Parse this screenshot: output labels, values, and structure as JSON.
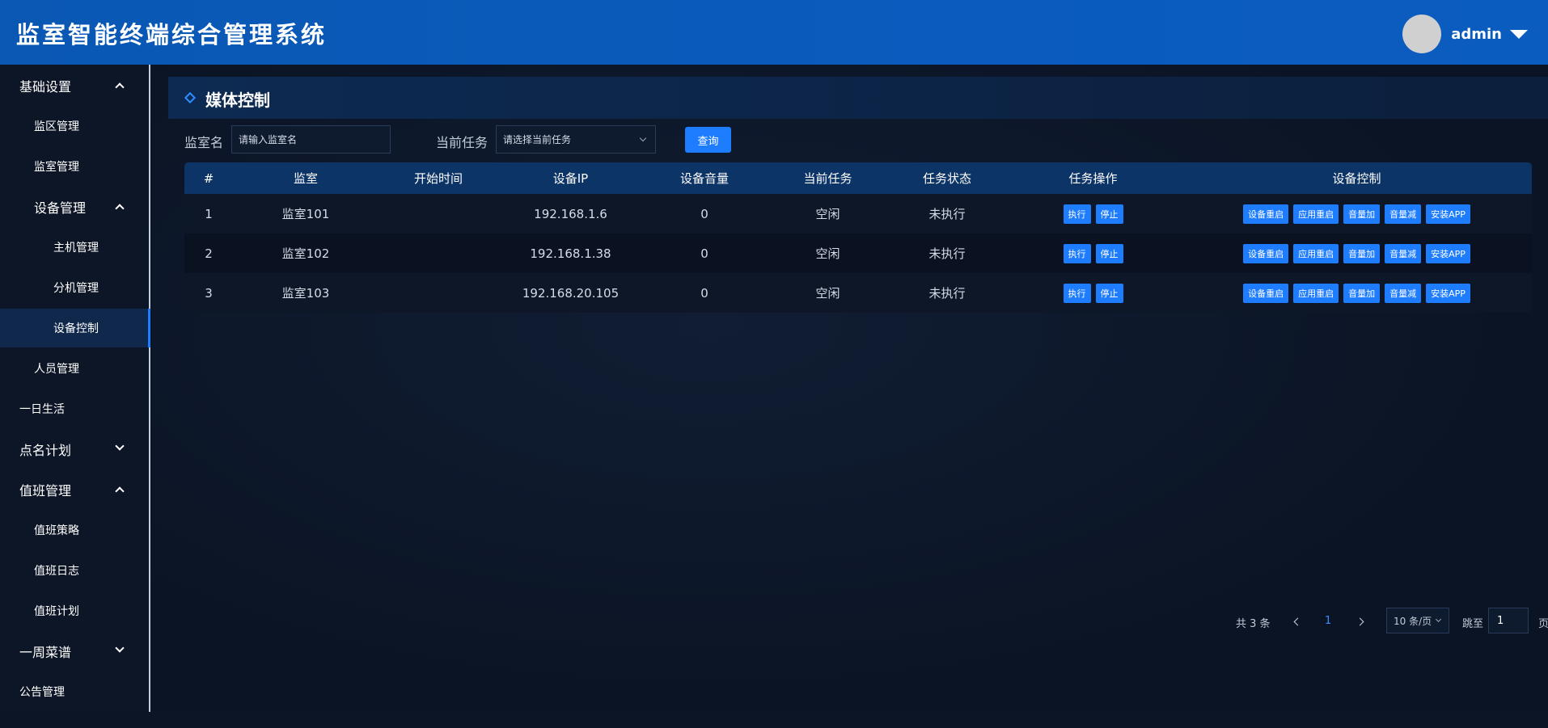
{
  "header": {
    "title": "监室智能终端综合管理系统",
    "user_name": "admin"
  },
  "sidebar": {
    "items": [
      {
        "label": "基础设置"
      },
      {
        "label": "监区管理"
      },
      {
        "label": "监室管理"
      },
      {
        "label": "设备管理"
      },
      {
        "label": "主机管理"
      },
      {
        "label": "分机管理"
      },
      {
        "label": "设备控制"
      },
      {
        "label": "人员管理"
      },
      {
        "label": "一日生活"
      },
      {
        "label": "点名计划"
      },
      {
        "label": "值班管理"
      },
      {
        "label": "值班策略"
      },
      {
        "label": "值班日志"
      },
      {
        "label": "值班计划"
      },
      {
        "label": "一周菜谱"
      },
      {
        "label": "公告管理"
      }
    ]
  },
  "panel": {
    "title": "媒体控制"
  },
  "filters": {
    "room_label": "监室名",
    "room_placeholder": "请输入监室名",
    "task_label": "当前任务",
    "task_placeholder": "请选择当前任务",
    "query_label": "查询"
  },
  "table": {
    "headers": [
      "#",
      "监室",
      "开始时间",
      "设备IP",
      "设备音量",
      "当前任务",
      "任务状态",
      "任务操作",
      "设备控制"
    ],
    "rows": [
      {
        "idx": "1",
        "room": "监室101",
        "start": "",
        "ip": "192.168.1.6",
        "volume": "0",
        "task": "空闲",
        "status": "未执行"
      },
      {
        "idx": "2",
        "room": "监室102",
        "start": "",
        "ip": "192.168.1.38",
        "volume": "0",
        "task": "空闲",
        "status": "未执行"
      },
      {
        "idx": "3",
        "room": "监室103",
        "start": "",
        "ip": "192.168.20.105",
        "volume": "0",
        "task": "空闲",
        "status": "未执行"
      }
    ],
    "op_buttons": [
      "执行",
      "停止"
    ],
    "ctrl_buttons": [
      "设备重启",
      "应用重启",
      "音量加",
      "音量减",
      "安装APP"
    ]
  },
  "pagination": {
    "total": "共 3 条",
    "current_page": "1",
    "page_size": "10 条/页",
    "jump_label": "跳至",
    "jump_value": "1",
    "page_suffix": "页"
  },
  "colors": {
    "accent": "#1e7cff",
    "header_bg": "#0a58b4",
    "background": "#0c1526"
  }
}
